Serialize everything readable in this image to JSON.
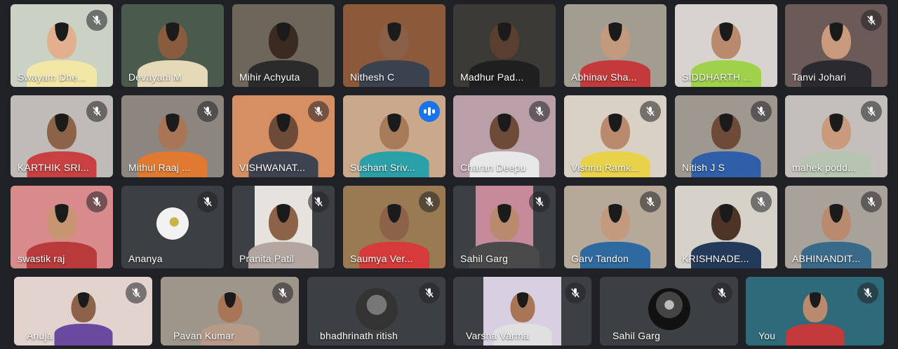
{
  "participants": [
    {
      "name": "Swayam Dhe...",
      "muted": true,
      "speaking": false,
      "camera": true,
      "bg": "#c9d2c5",
      "skin": "#e0b08f",
      "shirt": "#f3e7a6"
    },
    {
      "name": "Devayani M",
      "muted": false,
      "speaking": false,
      "camera": true,
      "bg": "#4a5b4e",
      "skin": "#8a5c3e",
      "shirt": "#e6d9b8"
    },
    {
      "name": "Mihir Achyuta",
      "muted": false,
      "speaking": false,
      "camera": true,
      "bg": "#6e665a",
      "skin": "#3a2a22",
      "shirt": "#2b2b2b"
    },
    {
      "name": "Nithesh C",
      "muted": false,
      "speaking": false,
      "camera": true,
      "bg": "#8c5a3a",
      "skin": "#8a6048",
      "shirt": "#3a4250"
    },
    {
      "name": "Madhur Pad...",
      "muted": false,
      "speaking": false,
      "camera": true,
      "bg": "#3c3a36",
      "skin": "#5a3f2e",
      "shirt": "#1f1f1f"
    },
    {
      "name": "Abhinav Sha...",
      "muted": false,
      "speaking": false,
      "camera": true,
      "bg": "#a39c90",
      "skin": "#c49a7e",
      "shirt": "#c43a3a"
    },
    {
      "name": "SIDDHARTH ...",
      "muted": false,
      "speaking": false,
      "camera": true,
      "bg": "#d7d4cf",
      "skin": "#b98a6e",
      "shirt": "#9fd14a"
    },
    {
      "name": "Tanvi Johari",
      "muted": true,
      "speaking": false,
      "camera": true,
      "bg": "#6b5a58",
      "skin": "#c99a7c",
      "shirt": "#2a2a30"
    },
    {
      "name": "KARTHIK SRI...",
      "muted": true,
      "speaking": false,
      "camera": true,
      "bg": "#bfbcb7",
      "skin": "#8c6348",
      "shirt": "#c84040"
    },
    {
      "name": "Mithul Raaj ...",
      "muted": true,
      "speaking": false,
      "camera": true,
      "bg": "#8d8680",
      "skin": "#a87556",
      "shirt": "#e07a30"
    },
    {
      "name": "VISHWANAT...",
      "muted": true,
      "speaking": false,
      "camera": true,
      "bg": "#d68f63",
      "skin": "#6e4a38",
      "shirt": "#3d4450"
    },
    {
      "name": "Sushant Sriv...",
      "muted": false,
      "speaking": true,
      "camera": true,
      "bg": "#c9a88b",
      "skin": "#a77a5a",
      "shirt": "#2aa0a8"
    },
    {
      "name": "Charan Deepu",
      "muted": true,
      "speaking": false,
      "camera": true,
      "bg": "#b9a0a8",
      "skin": "#6e4a38",
      "shirt": "#e8e8e8"
    },
    {
      "name": "Vishnu Ramk...",
      "muted": true,
      "speaking": false,
      "camera": true,
      "bg": "#d9d1c4",
      "skin": "#b98a6e",
      "shirt": "#e8d24a"
    },
    {
      "name": "Nitish J S",
      "muted": true,
      "speaking": false,
      "camera": true,
      "bg": "#9e9890",
      "skin": "#6e4a38",
      "shirt": "#2f5fa8"
    },
    {
      "name": "mahek podd...",
      "muted": true,
      "speaking": false,
      "camera": true,
      "bg": "#c3c0bb",
      "skin": "#c99a7c",
      "shirt": "#b7c4b0"
    },
    {
      "name": "swastik raj",
      "muted": true,
      "speaking": false,
      "camera": true,
      "bg": "#d98a8a",
      "skin": "#c79572",
      "shirt": "#b83a3a"
    },
    {
      "name": "Ananya",
      "muted": true,
      "speaking": false,
      "camera": false,
      "avatar": "light"
    },
    {
      "name": "Pranita Patil",
      "muted": true,
      "speaking": false,
      "camera": true,
      "bg": "#e6e3de",
      "skin": "#8c6348",
      "shirt": "#b3a6a0",
      "narrow": true
    },
    {
      "name": "Saumya Ver...",
      "muted": true,
      "speaking": false,
      "camera": true,
      "bg": "#9a7a52",
      "skin": "#8c6348",
      "shirt": "#d63a3a"
    },
    {
      "name": "Sahil Garg",
      "muted": true,
      "speaking": false,
      "camera": true,
      "bg": "#c78a9a",
      "skin": "#b98a6e",
      "shirt": "#4a4a4a",
      "narrow": true
    },
    {
      "name": "Garv Tandon",
      "muted": true,
      "speaking": false,
      "camera": true,
      "bg": "#b6a999",
      "skin": "#c49a7e",
      "shirt": "#2e6aa0"
    },
    {
      "name": "KRISHNADE...",
      "muted": true,
      "speaking": false,
      "camera": true,
      "bg": "#d6d2ca",
      "skin": "#4e3426",
      "shirt": "#243a5a"
    },
    {
      "name": "ABHINANDIT...",
      "muted": true,
      "speaking": false,
      "camera": true,
      "bg": "#a8a29a",
      "skin": "#b98a6e",
      "shirt": "#3a6a8a"
    },
    {
      "name": "Anuja",
      "muted": true,
      "speaking": false,
      "camera": true,
      "bg": "#e2d3cf",
      "skin": "#8c6348",
      "shirt": "#6a4aa0"
    },
    {
      "name": "Pavan Kumar",
      "muted": true,
      "speaking": false,
      "camera": true,
      "bg": "#9e968a",
      "skin": "#a87556",
      "shirt": "#b79a88"
    },
    {
      "name": "bhadhrinath ritish",
      "muted": true,
      "speaking": false,
      "camera": false,
      "avatar": "dark"
    },
    {
      "name": "Varsha Varma",
      "muted": true,
      "speaking": false,
      "camera": true,
      "bg": "#d8cfe0",
      "skin": "#a87556",
      "shirt": "#e0e0e0",
      "narrow": true
    },
    {
      "name": "Sahil Garg",
      "muted": true,
      "speaking": false,
      "camera": false,
      "avatar": "dark2"
    },
    {
      "name": "You",
      "muted": true,
      "speaking": false,
      "camera": true,
      "bg": "#2e6a7a",
      "skin": "#b98a6e",
      "shirt": "#c43a3a"
    }
  ],
  "colors": {
    "page_bg": "#202124",
    "tile_bg": "#3c4043",
    "speaking_ring": "#8ab4f8",
    "speaking_badge": "#1a73e8"
  },
  "icons": {
    "muted": "mic-off-icon",
    "speaking": "audio-level-icon"
  }
}
